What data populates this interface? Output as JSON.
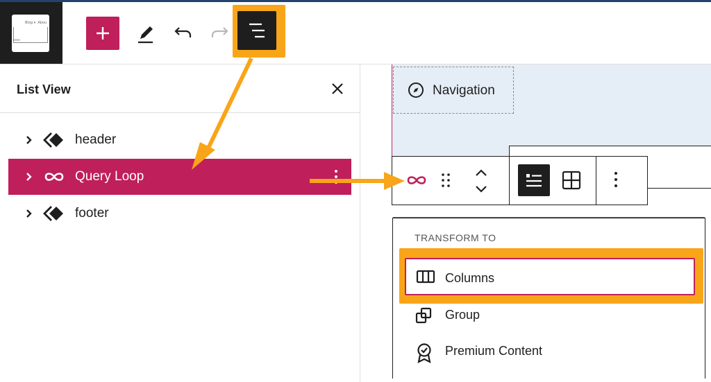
{
  "toolbar": {
    "site_thumbnail": {
      "nav_text_1": "Blog ▾",
      "nav_text_2": "Abou",
      "body_text": "eeee"
    },
    "buttons": [
      {
        "name": "add-block",
        "icon": "plus-icon"
      },
      {
        "name": "edit-tool",
        "icon": "pencil-icon"
      },
      {
        "name": "undo",
        "icon": "undo-icon"
      },
      {
        "name": "redo",
        "icon": "redo-icon",
        "disabled": true
      },
      {
        "name": "list-view",
        "icon": "list-view-icon",
        "active": true
      }
    ],
    "accent": "#bf1f5a"
  },
  "list_view": {
    "title": "List View",
    "items": [
      {
        "label": "header",
        "icon": "template-part-icon"
      },
      {
        "label": "Query Loop",
        "icon": "query-loop-icon",
        "selected": true
      },
      {
        "label": "footer",
        "icon": "template-part-icon"
      }
    ]
  },
  "canvas": {
    "navigation_label": "Navigation",
    "block_toolbar": [
      "query-loop-icon",
      "drag-handle-icon",
      "move-up-down-icon",
      "list-layout-icon",
      "grid-layout-icon",
      "more-options-icon"
    ]
  },
  "transform_menu": {
    "heading": "TRANSFORM TO",
    "items": [
      {
        "label": "Columns",
        "icon": "columns-icon",
        "highlighted": true
      },
      {
        "label": "Group",
        "icon": "group-icon"
      },
      {
        "label": "Premium Content",
        "icon": "premium-badge-icon"
      }
    ]
  },
  "colors": {
    "highlight": "#f9a51a",
    "selected_row": "#bf1f5a",
    "dark": "#1e1e1e"
  }
}
